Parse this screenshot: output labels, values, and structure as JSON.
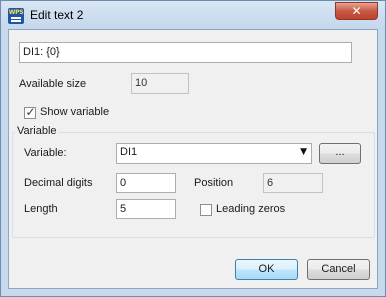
{
  "window": {
    "title": "Edit text 2",
    "app_icon_text": "WPS",
    "close_glyph": "✕"
  },
  "text_field": {
    "value": "DI1: {0}"
  },
  "available_size": {
    "label": "Available size",
    "value": "10"
  },
  "show_variable": {
    "label": "Show variable",
    "checked": true,
    "check_glyph": "✓"
  },
  "variable_group": {
    "title": "Variable",
    "variable": {
      "label": "Variable:",
      "selected": "DI1",
      "arrow_glyph": "▼"
    },
    "browse_button": {
      "label": "..."
    },
    "decimal_digits": {
      "label": "Decimal digits",
      "value": "0"
    },
    "position": {
      "label": "Position",
      "value": "6"
    },
    "length": {
      "label": "Length",
      "value": "5"
    },
    "leading_zeros": {
      "label": "Leading zeros",
      "checked": false
    }
  },
  "buttons": {
    "ok": "OK",
    "cancel": "Cancel"
  }
}
